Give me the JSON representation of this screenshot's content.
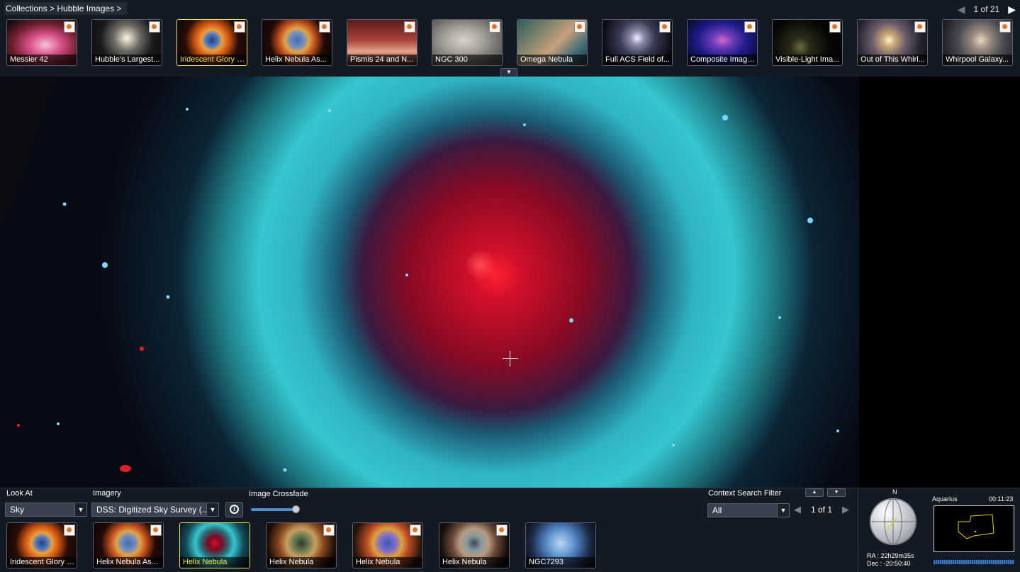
{
  "top": {
    "breadcrumb": "Collections > Hubble Images >",
    "pager": {
      "text": "1 of 21",
      "prev_icon": "triangle-left",
      "next_icon": "triangle-right"
    },
    "thumbnails": [
      {
        "label": "Messier 42",
        "selected": false
      },
      {
        "label": "Hubble's Largest...",
        "selected": false
      },
      {
        "label": "Iridescent Glory o...",
        "selected": true
      },
      {
        "label": "Helix Nebula As...",
        "selected": false
      },
      {
        "label": "Pismis 24 and N...",
        "selected": false
      },
      {
        "label": "NGC 300",
        "selected": false
      },
      {
        "label": "Omega Nebula",
        "selected": false
      },
      {
        "label": "Full ACS Field of...",
        "selected": false
      },
      {
        "label": "Composite Image...",
        "selected": false
      },
      {
        "label": "Visible-Light Ima...",
        "selected": false
      },
      {
        "label": "Out of This Whirl...",
        "selected": false
      },
      {
        "label": "Whirpool Galaxy...",
        "selected": false
      }
    ]
  },
  "bottom": {
    "look_at": {
      "label": "Look At",
      "value": "Sky"
    },
    "imagery": {
      "label": "Imagery",
      "value": "DSS: Digitized Sky Survey (..."
    },
    "crossfade": {
      "label": "Image Crossfade",
      "level": 0.88
    },
    "context_filter": {
      "label": "Context Search Filter",
      "value": "All"
    },
    "context_pager": "1 of 1",
    "thumbnails": [
      {
        "label": "Iridescent Glory o...",
        "selected": false
      },
      {
        "label": "Helix Nebula As...",
        "selected": false
      },
      {
        "label": "Helix Nebula",
        "selected": true
      },
      {
        "label": "Helix Nebula",
        "selected": false
      },
      {
        "label": "Helix Nebula",
        "selected": false
      },
      {
        "label": "Helix Nebula",
        "selected": false
      },
      {
        "label": "NGC7293",
        "selected": false
      }
    ]
  },
  "navigation": {
    "north": "N",
    "ra": "RA :  22h29m35s",
    "dec": "Dec :  -20:50:40",
    "constellation": "Aquarius",
    "clock": "00:11:23"
  },
  "colors": {
    "selected": "#f0e24a",
    "panel_bg": "#141a24",
    "nebula_ring": "#35c6cf",
    "nebula_core": "#c8102a"
  }
}
